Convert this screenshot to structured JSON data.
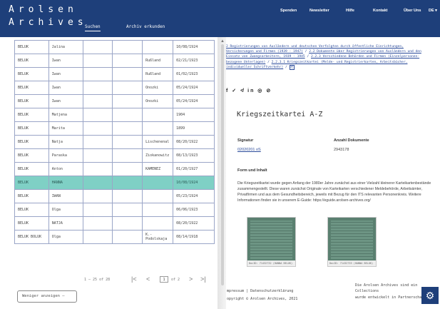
{
  "header": {
    "logo_line1": "Arolsen",
    "logo_line2": "Archives",
    "tabs": [
      {
        "label": "Suchen"
      },
      {
        "label": "Archiv erkunden"
      }
    ],
    "links": [
      {
        "label": "Spenden"
      },
      {
        "label": "Newsletter"
      },
      {
        "label": "Hilfe"
      },
      {
        "label": "Kontakt"
      },
      {
        "label": "Über Uns"
      },
      {
        "label": "DE ▾"
      }
    ]
  },
  "results": {
    "rows": [
      [
        "BELUK",
        "Jalina",
        "",
        "",
        "10/08/1924"
      ],
      [
        "BELUK",
        "Iwan",
        "",
        "Rußland",
        "02/21/1923"
      ],
      [
        "BELUK",
        "Iwan",
        "",
        "Rußland",
        "01/02/1923"
      ],
      [
        "BELUK",
        "Iwan",
        "",
        "Onozki",
        "05/24/1924"
      ],
      [
        "BELUK",
        "Iwan",
        "",
        "Onozki",
        "05/24/1924"
      ],
      [
        "BELUK",
        "Matjena",
        "",
        "",
        "1904"
      ],
      [
        "BELUK",
        "Marita",
        "",
        "",
        "1899"
      ],
      [
        "BELUK",
        "Natja",
        "",
        "Lischenenal",
        "08/20/1922"
      ],
      [
        "BELUK",
        "Paraska",
        "",
        "Ziokanowitz",
        "08/13/1923"
      ],
      [
        "BELUK",
        "Anton",
        "",
        "KAMENEZ",
        "01/20/1927"
      ],
      [
        "BELUK",
        "HANNA",
        "",
        "",
        "10/08/1924"
      ],
      [
        "BELUK",
        "IWAN",
        "",
        "",
        "05/23/1924"
      ],
      [
        "BELUK",
        "Olga",
        "",
        "",
        "06/06/1923"
      ],
      [
        "BELUK",
        "NATJA",
        "",
        "",
        "08/20/1922"
      ],
      [
        "BELUK BOLUK",
        "Olga",
        "",
        "K.-Podolskaja",
        "08/14/1918"
      ]
    ],
    "highlight_index": 10
  },
  "pagination": {
    "range_text": "1 — 25 of 28",
    "current_page": "1",
    "total_text": "of 2"
  },
  "show_less_label": "Weniger anzeigen —",
  "detail": {
    "breadcrumb": [
      "2 Registrierungen von Ausländern und deutschen Verfolgten durch öffentliche Einrichtungen, Versicherungen und Firmen (1939 - 1947)",
      "2.2 Dokumente über Registrierungen von Ausländern und den Einsatz von Zwangsarbeitern, 1939 - 1945",
      "2.2.3 Verschiedene Behörden und Firmen (Einzelpersonen-bezogene Unterlagen)",
      "2.2.3.1 Kriegszeitkartei (Melde- und Registrierkarten, Arbeitsbücher, individueller Schriftverkehr)"
    ],
    "share_icons": "f  ✓  ≮  in  ◎  ⊘",
    "title": "Kriegszeitkartei A-Z",
    "signatur_label": "Signatur",
    "signatur_value": "02020201 oS",
    "anzahl_label": "Anzahl Dokumente",
    "anzahl_value": "2943178",
    "section_title": "Form und Inhalt",
    "description": "Die Kriegszeitkartei wurde gegen Anfang der 1980er Jahre zunächst aus einer Vielzahl kleinerer Karteikartenbestände zusammengestellt. Diese waren zunächst Originale von Karteikarten verschiedener Meldebehörde, Arbeitsämter, Privatfirmen und aus dem Gesundheitsbereich, jeweils mit Bezug für den ITS relevanten Personenkreis. Weitere Informationen finden sie in unserem E-Guide: https://eguide.arolsen-archives.org/",
    "thumb1_caption": "DocID: 71432732 (HANNA BELUK)",
    "thumb2_caption": "DocID: 71432733 (HANNA BELUK)"
  },
  "footer": {
    "impressum": "mpressum  |  Datenschutzerklärung",
    "copyright": "opyright © Arolsen Archives, 2021",
    "partner1": "Die Arolsen Archives sind ein",
    "partner2": "Collections",
    "partner3": "wurde entwickelt in Partnerschaft"
  }
}
